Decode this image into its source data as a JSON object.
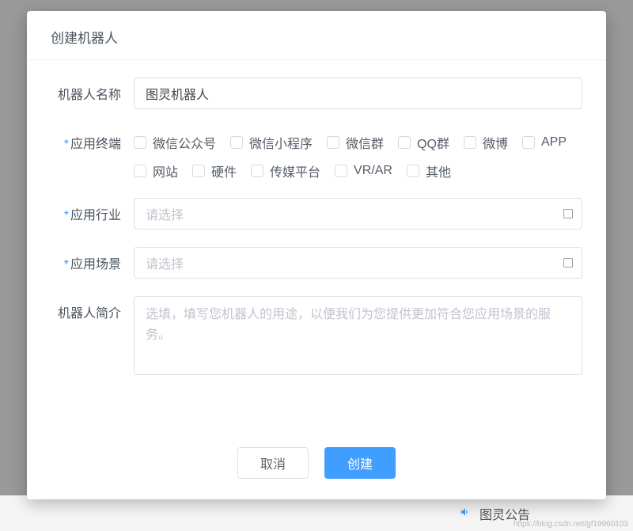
{
  "modal": {
    "title": "创建机器人",
    "labels": {
      "name": "机器人名称",
      "terminal": "应用终端",
      "industry": "应用行业",
      "scene": "应用场景",
      "intro": "机器人简介"
    },
    "name_value": "图灵机器人",
    "terminal_options": [
      "微信公众号",
      "微信小程序",
      "微信群",
      "QQ群",
      "微博",
      "APP",
      "网站",
      "硬件",
      "传媒平台",
      "VR/AR",
      "其他"
    ],
    "industry_placeholder": "请选择",
    "scene_placeholder": "请选择",
    "intro_placeholder": "选填，填写您机器人的用途，以便我们为您提供更加符合您应用场景的服务。",
    "buttons": {
      "cancel": "取消",
      "create": "创建"
    }
  },
  "bottom": {
    "announcement": "图灵公告"
  },
  "watermark": "https://blog.csdn.net/gf19960103"
}
